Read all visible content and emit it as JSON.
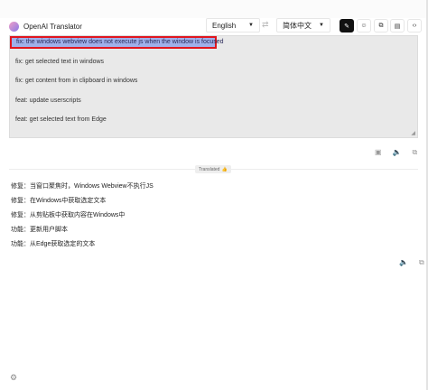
{
  "app": {
    "title": "OpenAI Translator"
  },
  "languages": {
    "source": "English",
    "target": "简体中文",
    "swap_icon": "swap-arrows-icon"
  },
  "toolbar": {
    "buttons": [
      {
        "name": "translate-mode-button",
        "glyph": "✎"
      },
      {
        "name": "polish-mode-button",
        "glyph": "☺"
      },
      {
        "name": "summarize-mode-button",
        "glyph": "⧉"
      },
      {
        "name": "analyze-mode-button",
        "glyph": "▤"
      },
      {
        "name": "code-mode-button",
        "glyph": "‹›"
      }
    ]
  },
  "input": {
    "selected_line": "fix: the windows webview does not execute js when the window is focused",
    "lines": [
      "fix: get selected text in windows",
      "fix: get content from in clipboard in windows",
      "feat: update userscripts",
      "feat: get selected text from Edge"
    ]
  },
  "input_actions": {
    "ocr_icon": "▣",
    "speak_icon": "🔈",
    "copy_icon": "⧉",
    "clear_icon": "⌫"
  },
  "status": {
    "badge_label": "Translated",
    "badge_emoji": "👍"
  },
  "output": {
    "lines": [
      "修复：当窗口聚焦时，Windows Webview不执行JS",
      "修复：在Windows中获取选定文本",
      "修复：从剪贴板中获取内容在Windows中",
      "功能：更新用户脚本",
      "功能：从Edge获取选定的文本"
    ]
  },
  "output_actions": {
    "speak_icon": "🔈",
    "copy_icon": "⧉"
  },
  "footer": {
    "settings_icon": "⚙"
  }
}
